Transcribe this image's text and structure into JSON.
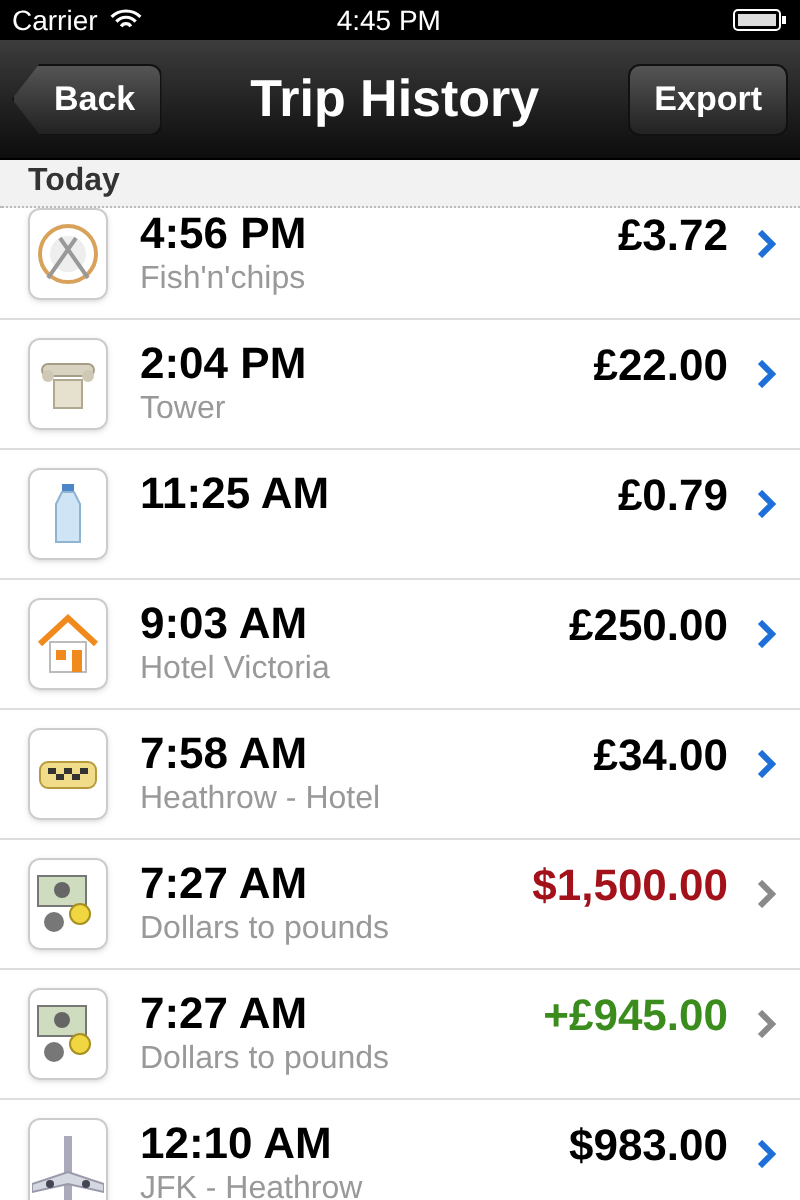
{
  "status_bar": {
    "carrier": "Carrier",
    "time": "4:45 PM"
  },
  "nav": {
    "back": "Back",
    "title": "Trip History",
    "action": "Export"
  },
  "section": {
    "title": "Today"
  },
  "rows": [
    {
      "kind": "plate",
      "time": "4:56 PM",
      "subtitle": "Fish'n'chips",
      "amount": "£3.72",
      "color": "#000000",
      "muted": false
    },
    {
      "kind": "column",
      "time": "2:04 PM",
      "subtitle": "Tower",
      "amount": "£22.00",
      "color": "#000000",
      "muted": false
    },
    {
      "kind": "bottle",
      "time": "11:25 AM",
      "amount": "£0.79",
      "color": "#000000",
      "muted": false
    },
    {
      "kind": "house",
      "time": "9:03 AM",
      "subtitle": "Hotel Victoria",
      "amount": "£250.00",
      "color": "#000000",
      "muted": false
    },
    {
      "kind": "taxi",
      "time": "7:58 AM",
      "subtitle": "Heathrow - Hotel",
      "amount": "£34.00",
      "color": "#000000",
      "muted": false
    },
    {
      "kind": "money",
      "time": "7:27 AM",
      "subtitle": "Dollars to pounds",
      "amount": "$1,500.00",
      "color": "#a3121a",
      "muted": true
    },
    {
      "kind": "money",
      "time": "7:27 AM",
      "subtitle": "Dollars to pounds",
      "amount": "+£945.00",
      "color": "#3a8d1c",
      "muted": true
    },
    {
      "kind": "plane",
      "time": "12:10 AM",
      "subtitle": "JFK - Heathrow",
      "amount": "$983.00",
      "color": "#000000",
      "muted": false
    }
  ]
}
